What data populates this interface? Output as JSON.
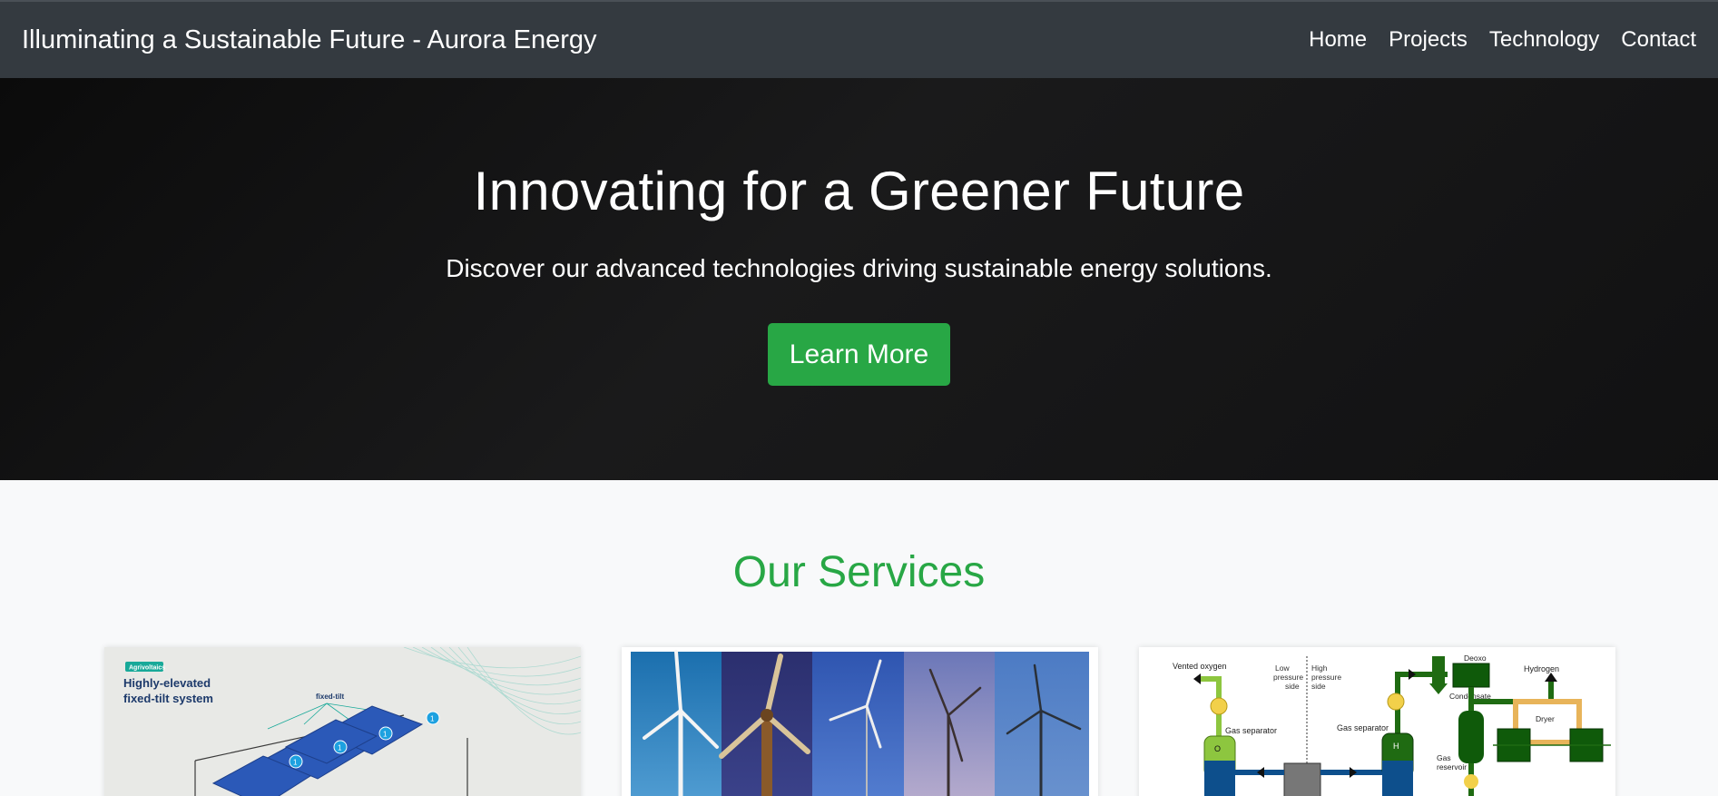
{
  "navbar": {
    "brand": "Illuminating a Sustainable Future - Aurora Energy",
    "links": [
      "Home",
      "Projects",
      "Technology",
      "Contact"
    ]
  },
  "hero": {
    "title": "Innovating for a Greener Future",
    "subtitle": "Discover our advanced technologies driving sustainable energy solutions.",
    "button_label": "Learn More"
  },
  "services": {
    "title": "Our Services",
    "cards": [
      {
        "image": "agrivoltaics-solar-panels",
        "badge": "Agrivoltaics",
        "heading_line1": "Highly-elevated",
        "heading_line2": "fixed-tilt system",
        "callout": "fixed-tilt",
        "markers": [
          "1",
          "1",
          "1",
          "1"
        ]
      },
      {
        "image": "wind-turbines-collage"
      },
      {
        "image": "hydrogen-electrolysis-diagram",
        "labels": {
          "vented_oxygen": "Vented oxygen",
          "low_pressure_1": "Low",
          "low_pressure_2": "pressure",
          "low_pressure_3": "side",
          "high_pressure_1": "High",
          "high_pressure_2": "pressure",
          "high_pressure_3": "side",
          "deoxo": "Deoxo",
          "hydrogen": "Hydrogen",
          "condensate": "Condensate",
          "gas_separator_left": "Gas separator",
          "gas_separator_right": "Gas separator",
          "dryer": "Dryer",
          "o2": "O",
          "h2": "H",
          "gas_reservoir_1": "Gas",
          "gas_reservoir_2": "reservoir"
        }
      }
    ]
  },
  "colors": {
    "navbar": "#343a40",
    "accent": "#28a745",
    "hero_bg": "#151516"
  }
}
